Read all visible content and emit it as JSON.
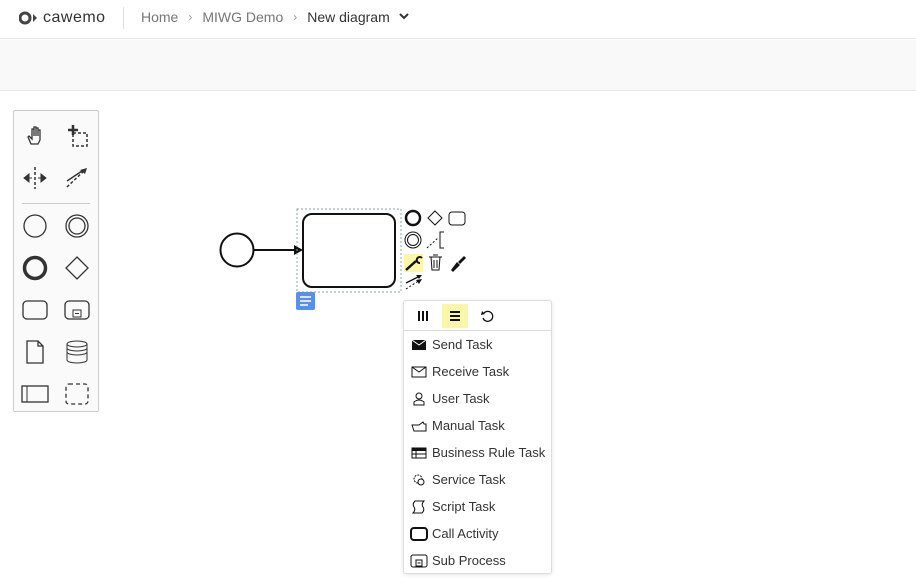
{
  "header": {
    "logo": "cawemo",
    "breadcrumbs": [
      "Home",
      "MIWG Demo"
    ],
    "current": "New diagram"
  },
  "palette": {
    "tools": [
      "hand-tool",
      "lasso-tool",
      "space-tool",
      "global-connect-tool",
      "start-event",
      "intermediate-event",
      "end-event",
      "gateway",
      "task",
      "subprocess",
      "data-object",
      "data-store",
      "pool",
      "group"
    ]
  },
  "popup": {
    "header_buttons": [
      "parallel-multi-instance",
      "sequential-multi-instance",
      "loop"
    ],
    "items": [
      {
        "label": "Send Task",
        "icon": "envelope-filled-icon"
      },
      {
        "label": "Receive Task",
        "icon": "envelope-icon"
      },
      {
        "label": "User Task",
        "icon": "user-icon"
      },
      {
        "label": "Manual Task",
        "icon": "hand-icon"
      },
      {
        "label": "Business Rule Task",
        "icon": "table-icon"
      },
      {
        "label": "Service Task",
        "icon": "gear-icon"
      },
      {
        "label": "Script Task",
        "icon": "script-icon"
      },
      {
        "label": "Call Activity",
        "icon": "call-activity-icon"
      },
      {
        "label": "Sub Process",
        "icon": "subprocess-icon"
      }
    ]
  },
  "colors": {
    "highlight": "#fbf7a8",
    "comment": "#5b8ee6"
  }
}
